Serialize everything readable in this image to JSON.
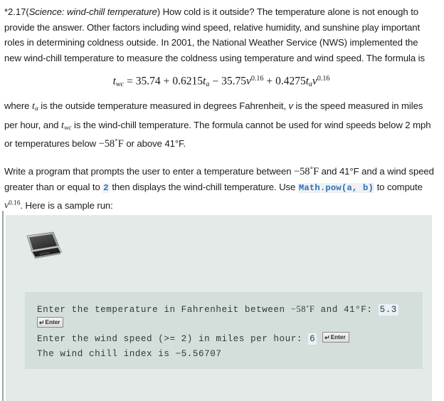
{
  "exercise": {
    "number": "*2.17",
    "title_prefix": "(",
    "title_italic": "Science: wind-chill temperature",
    "title_suffix": ")",
    "p1_a": " How cold is it outside? The temperature alone is not enough to provide the answer. Other factors including wind speed, relative humidity, and sunshine play important roles in determining coldness outside. In 2001, the National Weather Service (NWS) implemented the new wind-chill temperature to measure the coldness using temperature and wind speed. The formula is"
  },
  "formula": {
    "lhs_var": "t",
    "lhs_sub": "wc",
    "eq": "=",
    "c1": "35.74",
    "op1": "+",
    "c2": "0.6215",
    "v2": "t",
    "v2_sub": "a",
    "op2": "−",
    "c3": "35.75",
    "v3": "v",
    "v3_exp": "0.16",
    "op3": "+",
    "c4": "0.4275",
    "v4a": "t",
    "v4a_sub": "a",
    "v4b": "v",
    "v4b_exp": "0.16",
    "plain": "t_wc = 35.74 + 0.6215 t_a − 35.75 v^0.16 + 0.4275 t_a v^0.16"
  },
  "para2": {
    "s1": "where ",
    "var_ta": "t",
    "var_ta_sub": "a",
    "s2": " is the outside temperature measured in degrees Fahrenheit, ",
    "var_v": "v",
    "s3": " is the speed measured in miles per hour, and ",
    "var_twc": "t",
    "var_twc_sub": "wc",
    "s4": " is the wind-chill temperature. The formula cannot be used for wind speeds below 2 mph or temperatures below ",
    "low_temp": "−58˚F",
    "s5": " or above ",
    "high_temp": "41°F",
    "s6": "."
  },
  "para3": {
    "s1": "Write a program that prompts the user to enter a temperature between ",
    "low_temp": "−58˚F",
    "s2": " and ",
    "high_temp": "41°F",
    "s3": " and a wind speed greater than or equal to ",
    "code_two": "2",
    "s4": " then displays the wind-chill temperature. Use ",
    "code_pow": "Math.pow(a, b)",
    "s5": " to compute ",
    "var_v": "v",
    "var_v_exp": "0.16",
    "s6": ". Here is a sample run:"
  },
  "sample_run": {
    "icon": "laptop-icon",
    "line1_text": "Enter the temperature in Fahrenheit between ",
    "line1_low": "−58˚F",
    "line1_mid": " and ",
    "line1_high": "41°F",
    "line1_colon": ": ",
    "line1_value": "5.3",
    "enter_key_1": "Enter",
    "enter_key_arrow": "↵",
    "line2_text": "Enter the wind speed (>= 2) in miles per hour: ",
    "line2_value": "6",
    "enter_key_2": "Enter",
    "line3_text": "The wind chill index is ",
    "line3_value": "−5.56707"
  },
  "colors": {
    "panel_bg": "#e3eae7",
    "console_bg": "#d4dfdc",
    "console_text": "#2d3b39",
    "code_blue": "#2f6fb4",
    "value_highlight": "#e9f1f7",
    "left_rule": "#9aa5a2",
    "body_text": "#1c1c1c"
  }
}
